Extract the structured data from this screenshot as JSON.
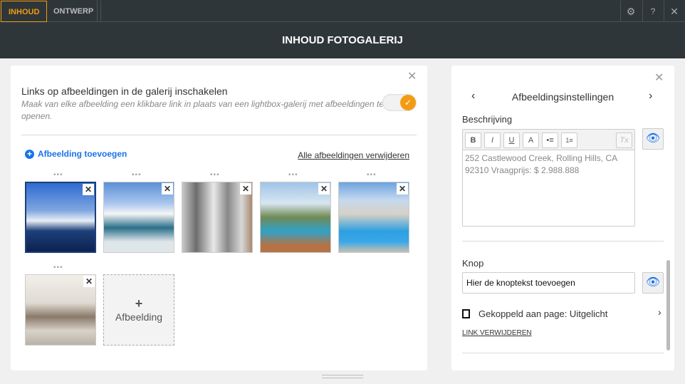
{
  "tabs": [
    {
      "label": "INHOUD",
      "active": true
    },
    {
      "label": "ONTWERP",
      "active": false
    }
  ],
  "toolbar_icons": [
    "gear-icon",
    "help-icon",
    "close-icon"
  ],
  "header": {
    "title": "INHOUD FOTOGALERIJ"
  },
  "left": {
    "toggle_title": "Links op afbeeldingen in de galerij inschakelen",
    "toggle_desc": "Maak van elke afbeelding een klikbare link in plaats van een lightbox-galerij met afbeeldingen te openen.",
    "toggle_on": true,
    "add_label": "Afbeelding toevoegen",
    "remove_all": "Alle afbeeldingen verwijderen",
    "images": [
      "pool-villa",
      "modern-house",
      "interior-glass",
      "resort-pool",
      "mansion-pool",
      "living-room"
    ],
    "add_tile": "Afbeelding",
    "accent": "#1a73e8"
  },
  "right": {
    "title": "Afbeeldingsinstellingen",
    "desc_label": "Beschrijving",
    "editor_buttons": [
      "B",
      "I",
      "U",
      "A",
      "•≡",
      "1≡",
      "Tx"
    ],
    "description": "252 Castlewood Creek, Rolling Hills, CA 92310 Vraagprijs: $ 2.988.888",
    "button_label": "Knop",
    "button_text": "Hier de knoptekst toevoegen",
    "linked": "Gekoppeld aan page: Uitgelicht",
    "unlink": "LINK VERWIJDEREN"
  },
  "colors": {
    "orange": "#f39c12",
    "dark": "#2f3639"
  }
}
